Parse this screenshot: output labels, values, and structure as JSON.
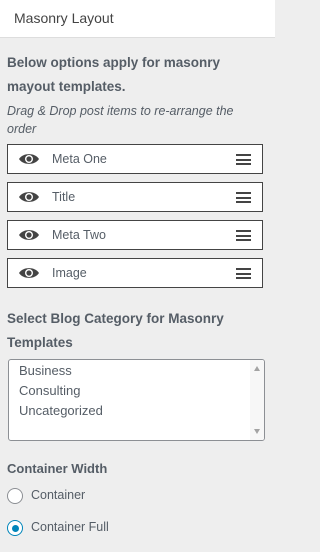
{
  "header": {
    "title": "Masonry Layout"
  },
  "description": "Below options apply for masonry mayout templates.",
  "sort_hint": "Drag & Drop post items to re-arrange the order",
  "sort_items": [
    {
      "label": "Meta One",
      "icon": "eye-icon",
      "handle_icon": "drag-handle-icon"
    },
    {
      "label": "Title",
      "icon": "eye-icon",
      "handle_icon": "drag-handle-icon"
    },
    {
      "label": "Meta Two",
      "icon": "eye-icon",
      "handle_icon": "drag-handle-icon"
    },
    {
      "label": "Image",
      "icon": "eye-icon",
      "handle_icon": "drag-handle-icon"
    }
  ],
  "category": {
    "label": "Select Blog Category for Masonry Templates",
    "options": [
      "Business",
      "Consulting",
      "Uncategorized"
    ]
  },
  "container_width": {
    "label": "Container Width",
    "options": [
      {
        "label": "Container",
        "checked": false
      },
      {
        "label": "Container Full",
        "checked": true
      }
    ],
    "accent_color": "#0085ba"
  }
}
